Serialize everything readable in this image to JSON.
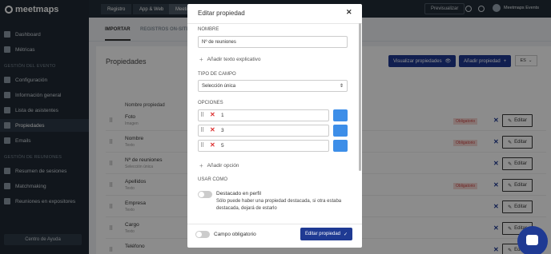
{
  "brand": {
    "name": "meetmaps"
  },
  "sidebar": {
    "items": [
      {
        "label": "Dashboard"
      },
      {
        "label": "Métricas"
      },
      {
        "label": "Configuración"
      },
      {
        "label": "Información general"
      },
      {
        "label": "Lista de asistentes"
      },
      {
        "label": "Propiedades"
      },
      {
        "label": "Emails"
      },
      {
        "label": "Resumen de sesiones"
      },
      {
        "label": "Matchmaking"
      },
      {
        "label": "Reuniones en expositores"
      }
    ],
    "section_event": "GESTIÓN DEL EVENTO",
    "section_meetings": "GESTIÓN DE REUNIONES",
    "help_button": "Centro de Ayuda"
  },
  "topbar": {
    "tabs": [
      "Registro",
      "App & Web",
      "Meeti"
    ],
    "preview": "Previsualizar",
    "user": "Meetmaps Events"
  },
  "subtabs": [
    "IMPORTAR",
    "REGISTROS ON-SITE"
  ],
  "panel": {
    "title": "Propiedades",
    "view_button": "Visualizar propiedades",
    "add_button": "Añadir propiedad",
    "lang": "ES",
    "column_header": "Nombre propiedad",
    "badge": "Obligatorio",
    "edit_label": "Editar",
    "rows": [
      {
        "name": "Foto",
        "type": "Imagen",
        "required": true
      },
      {
        "name": "Nombre",
        "type": "Texto",
        "required": true
      },
      {
        "name": "Nº de reuniones",
        "type": "Selección única",
        "required": false
      },
      {
        "name": "Apellidos",
        "type": "Texto",
        "required": true
      },
      {
        "name": "Empresa",
        "type": "Texto",
        "required": false
      },
      {
        "name": "Cargo",
        "type": "Texto",
        "required": false
      },
      {
        "name": "Teléfono",
        "type": "",
        "required": false
      }
    ]
  },
  "modal": {
    "title": "Editar propiedad",
    "name_label": "NOMBRE",
    "name_value": "Nº de reuniones",
    "add_help": "Añadir texto explicativo",
    "type_label": "TIPO DE CAMPO",
    "type_value": "Selección única",
    "options_label": "OPCIONES",
    "options": [
      "1",
      "3",
      "5"
    ],
    "add_option": "Añadir opción",
    "use_as_label": "USAR COMO",
    "featured_label": "Destacado en perfil",
    "featured_desc": "Sólo puede haber una propiedad destacada, si otra estaba destacada, dejará de estarlo",
    "required_label": "Campo obligatorio",
    "submit": "Editar propiedad"
  },
  "colors": {
    "primary": "#1f3a93",
    "sidebar": "#1f2933",
    "option_color": "#3d8ee8",
    "badge_bg": "#f6d7d3"
  }
}
